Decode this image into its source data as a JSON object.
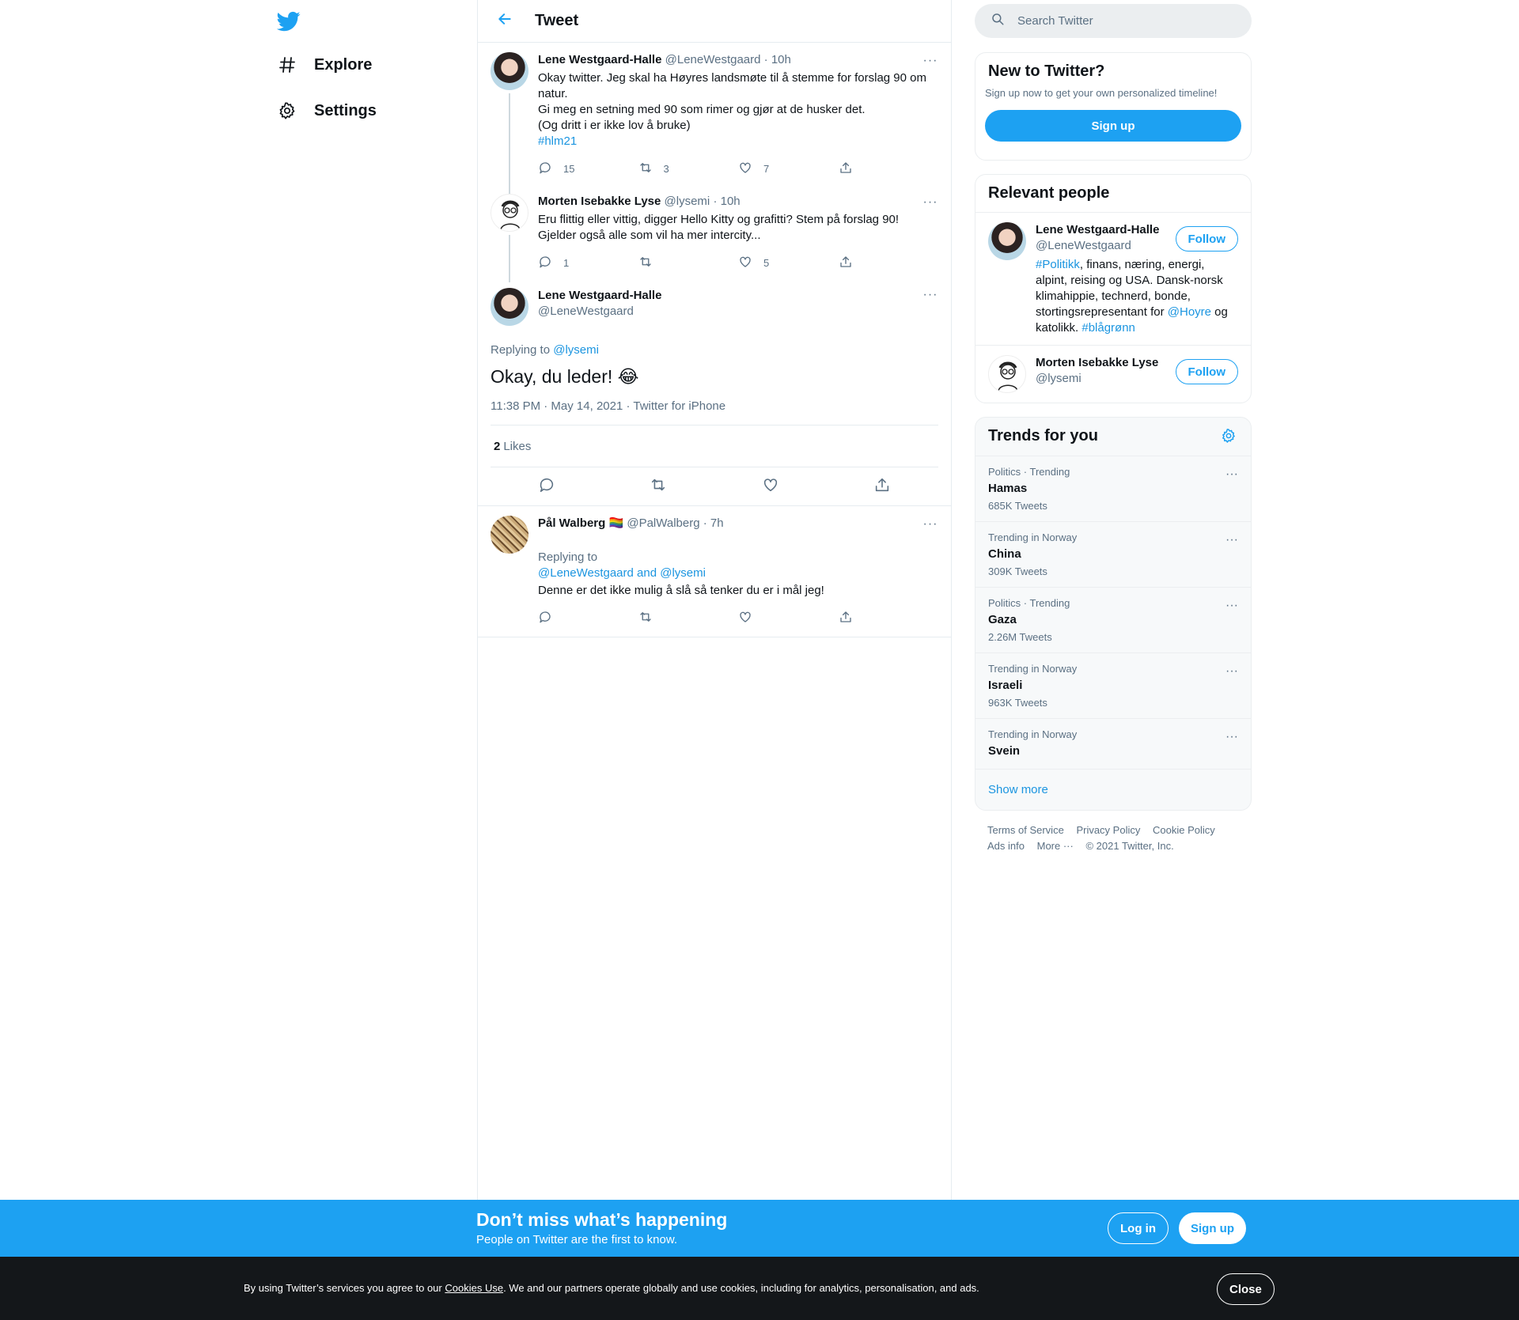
{
  "nav": {
    "logo_icon": "twitter-bird-icon",
    "items": [
      {
        "label": "Explore",
        "icon": "hashtag-icon"
      },
      {
        "label": "Settings",
        "icon": "gear-icon"
      }
    ]
  },
  "header": {
    "title": "Tweet",
    "back_icon": "arrow-left-icon"
  },
  "thread": [
    {
      "name": "Lene Westgaard-Halle",
      "handle": "@LeneWestgaard",
      "dot": "·",
      "time": "10h",
      "text": "Okay twitter. Jeg skal ha Høyres landsmøte til å stemme for forslag 90 om natur.\nGi meg en setning med 90 som rimer og gjør at de husker det.\n(Og dritt i er ikke lov å bruke)",
      "hashtag": "#hlm21",
      "replies": "15",
      "retweets": "3",
      "likes": "7"
    },
    {
      "name": "Morten Isebakke Lyse",
      "handle": "@lysemi",
      "dot": "·",
      "time": "10h",
      "text": "Eru flittig eller vittig, digger Hello Kitty og grafitti? Stem på forslag 90! Gjelder også alle som vil ha mer intercity...",
      "replies": "1",
      "retweets": "",
      "likes": "5"
    }
  ],
  "main_tweet": {
    "name": "Lene Westgaard-Halle",
    "handle": "@LeneWestgaard",
    "replying_prefix": "Replying to",
    "replying_to": "@lysemi",
    "text": "Okay, du leder! 😂",
    "meta": "11:38 PM · May 14, 2021 · Twitter for iPhone",
    "likes_count": "2",
    "likes_label": "Likes"
  },
  "replies": [
    {
      "name": "Pål Walberg",
      "flag": "🏳️‍🌈",
      "handle": "@PalWalberg",
      "dot": "·",
      "time": "7h",
      "replying_prefix": "Replying to",
      "replying_to": "@LeneWestgaard and @lysemi",
      "text": "Denne er det ikke mulig å slå så tenker du er i mål jeg!"
    }
  ],
  "search": {
    "placeholder": "Search Twitter"
  },
  "new_to_twitter": {
    "title": "New to Twitter?",
    "subtitle": "Sign up now to get your own personalized timeline!",
    "button": "Sign up"
  },
  "relevant_people": {
    "title": "Relevant people",
    "people": [
      {
        "name": "Lene Westgaard-Halle",
        "handle": "@LeneWestgaard",
        "bio_tag": "#Politikk",
        "bio_1": ", finans, næring, energi, alpint, reising og USA. Dansk-norsk klimahippie, technerd, bonde, stortingsrepresentant for ",
        "bio_mention": "@Hoyre",
        "bio_2": " og katolikk. ",
        "bio_tag2": "#blågrønn",
        "follow": "Follow"
      },
      {
        "name": "Morten Isebakke Lyse",
        "handle": "@lysemi",
        "follow": "Follow"
      }
    ]
  },
  "trends": {
    "title": "Trends for you",
    "items": [
      {
        "meta": "Politics · Trending",
        "name": "Hamas",
        "count": "685K Tweets"
      },
      {
        "meta": "Trending in Norway",
        "name": "China",
        "count": "309K Tweets"
      },
      {
        "meta": "Politics · Trending",
        "name": "Gaza",
        "count": "2.26M Tweets"
      },
      {
        "meta": "Trending in Norway",
        "name": "Israeli",
        "count": "963K Tweets"
      },
      {
        "meta": "Trending in Norway",
        "name": "Svein",
        "count": ""
      }
    ],
    "show_more": "Show more"
  },
  "footer": {
    "terms": "Terms of Service",
    "privacy": "Privacy Policy",
    "cookie": "Cookie Policy",
    "ads": "Ads info",
    "more": "More ···",
    "copyright": "© 2021 Twitter, Inc."
  },
  "banner": {
    "title": "Don’t miss what’s happening",
    "subtitle": "People on Twitter are the first to know.",
    "login": "Log in",
    "signup": "Sign up"
  },
  "cookie_bar": {
    "prefix": "By using Twitter’s services you agree to our ",
    "link": "Cookies Use",
    "suffix": ". We and our partners operate globally and use cookies, including for analytics, personalisation, and ads.",
    "close": "Close"
  },
  "colors": {
    "accent": "#1da1f2",
    "link": "#1b95e0",
    "muted": "#5b7083",
    "cookie_bg": "#14171a"
  }
}
